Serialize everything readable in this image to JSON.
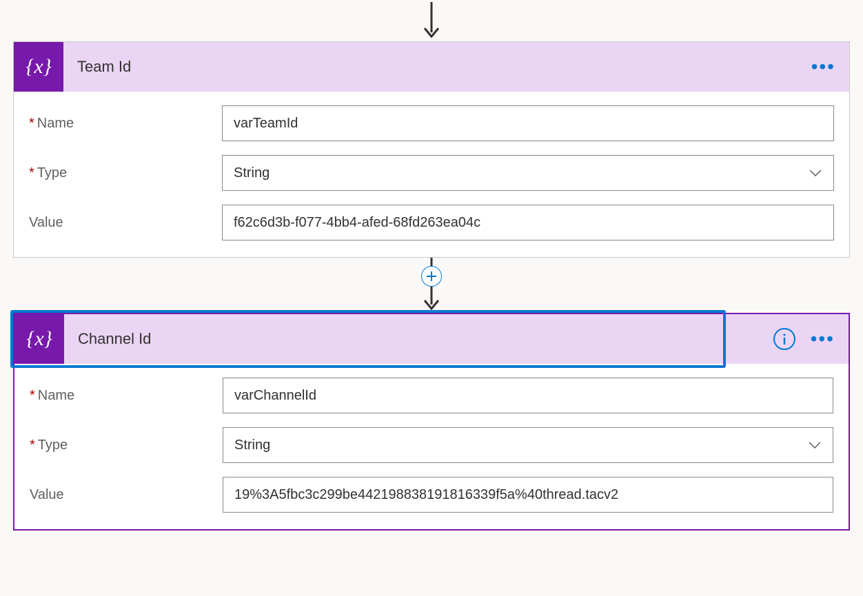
{
  "arrow_icon": "arrow-down",
  "plus_icon": "plus",
  "cards": [
    {
      "icon_badge": "variable-icon",
      "title": "Team Id",
      "selected": false,
      "has_info": false,
      "fields": {
        "name_label": "Name",
        "name_value": "varTeamId",
        "name_required": true,
        "type_label": "Type",
        "type_value": "String",
        "type_required": true,
        "value_label": "Value",
        "value_value": "f62c6d3b-f077-4bb4-afed-68fd263ea04c",
        "value_required": false
      }
    },
    {
      "icon_badge": "variable-icon",
      "title": "Channel Id",
      "selected": true,
      "has_info": true,
      "fields": {
        "name_label": "Name",
        "name_value": "varChannelId",
        "name_required": true,
        "type_label": "Type",
        "type_value": "String",
        "type_required": true,
        "value_label": "Value",
        "value_value": "19%3A5fbc3c299be442198838191816339f5a%40thread.tacv2",
        "value_required": false
      }
    }
  ],
  "required_marker": "*",
  "icon_glyph": "{x}"
}
